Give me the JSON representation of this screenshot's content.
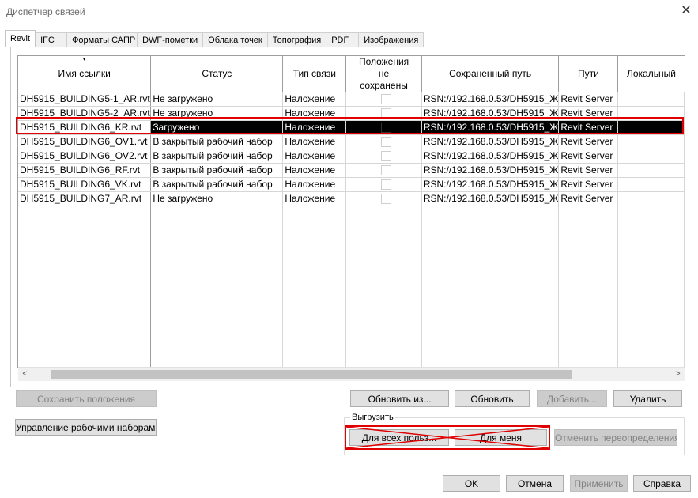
{
  "window": {
    "title": "Диспетчер связей",
    "close_glyph": "✕"
  },
  "tabs": [
    "Revit",
    "IFC",
    "Форматы САПР",
    "DWF-пометки",
    "Облака точек",
    "Топография",
    "PDF",
    "Изображения"
  ],
  "grid": {
    "sort_glyph": "▾",
    "columns": [
      "Имя ссылки",
      "Статус",
      "Тип связи",
      "Положения не сохранены",
      "Сохраненный путь",
      "Пути",
      "Локальный"
    ],
    "rows": [
      {
        "name": "DH5915_BUILDING5-1_AR.rvt",
        "status": "Не загружено",
        "type": "Наложение",
        "path": "RSN://192.168.0.53/DH5915_Ж",
        "paths": "Revit Server"
      },
      {
        "name": "DH5915_BUILDING5-2_AR.rvt",
        "status": "Не загружено",
        "type": "Наложение",
        "path": "RSN://192.168.0.53/DH5915_Ж",
        "paths": "Revit Server"
      },
      {
        "name": "DH5915_BUILDING6_KR.rvt",
        "status": "Загружено",
        "type": "Наложение",
        "path": "RSN://192.168.0.53/DH5915_Ж",
        "paths": "Revit Server"
      },
      {
        "name": "DH5915_BUILDING6_OV1.rvt",
        "status": "В закрытый рабочий набор",
        "type": "Наложение",
        "path": "RSN://192.168.0.53/DH5915_Ж",
        "paths": "Revit Server"
      },
      {
        "name": "DH5915_BUILDING6_OV2.rvt",
        "status": "В закрытый рабочий набор",
        "type": "Наложение",
        "path": "RSN://192.168.0.53/DH5915_Ж",
        "paths": "Revit Server"
      },
      {
        "name": "DH5915_BUILDING6_RF.rvt",
        "status": "В закрытый рабочий набор",
        "type": "Наложение",
        "path": "RSN://192.168.0.53/DH5915_Ж",
        "paths": "Revit Server"
      },
      {
        "name": "DH5915_BUILDING6_VK.rvt",
        "status": "В закрытый рабочий набор",
        "type": "Наложение",
        "path": "RSN://192.168.0.53/DH5915_Ж",
        "paths": "Revit Server"
      },
      {
        "name": "DH5915_BUILDING7_AR.rvt",
        "status": "Не загружено",
        "type": "Наложение",
        "path": "RSN://192.168.0.53/DH5915_Ж",
        "paths": "Revit Server"
      }
    ],
    "scroll_left": "<",
    "scroll_right": ">"
  },
  "buttons": {
    "save_positions": "Сохранить положения",
    "manage_worksets": "Управление рабочими наборами",
    "reload_from": "Обновить из...",
    "reload": "Обновить",
    "add": "Добавить...",
    "remove": "Удалить",
    "unload_group": "Выгрузить",
    "for_all_users": "Для всех польз...",
    "for_me": "Для меня",
    "undo_overrides": "Отменить переопределения",
    "ok": "OK",
    "cancel": "Отмена",
    "apply": "Применить",
    "help": "Справка"
  },
  "colors": {
    "highlight": "#e00000",
    "selection": "#000000",
    "default_button_border": "#0078d7"
  }
}
